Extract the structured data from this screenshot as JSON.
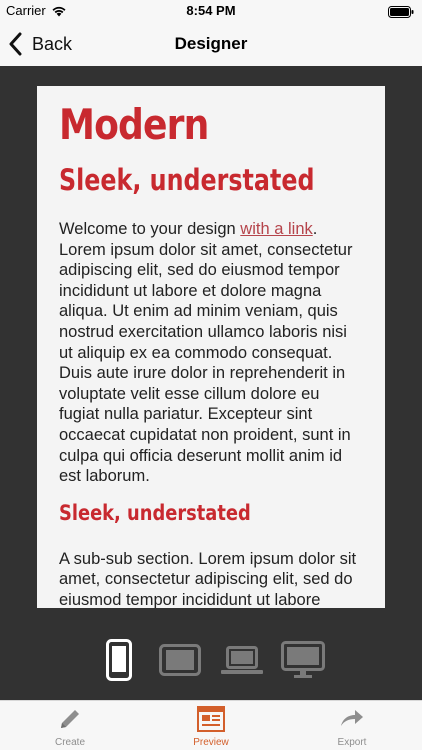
{
  "status_bar": {
    "carrier": "Carrier",
    "time": "8:54 PM"
  },
  "nav": {
    "back_label": "Back",
    "title": "Designer"
  },
  "preview": {
    "heading1": "Modern",
    "heading2": "Sleek, understated",
    "intro_text": "Welcome to your design ",
    "link_text": "with a link",
    "intro_after_link": ".",
    "body": "Lorem ipsum dolor sit amet, consectetur adipiscing elit, sed do eiusmod tempor incididunt ut labore et dolore magna aliqua. Ut enim ad minim veniam, quis nostrud exercitation ullamco laboris nisi ut aliquip ex ea commodo consequat. Duis aute irure dolor in reprehenderit in voluptate velit esse cillum dolore eu fugiat nulla pariatur. Excepteur sint occaecat cupidatat non proident, sunt in culpa qui officia deserunt mollit anim id est laborum.",
    "heading3": "Sleek, understated",
    "sub_body": "A sub-sub section. Lorem ipsum dolor sit amet, consectetur adipiscing elit, sed do eiusmod tempor incididunt ut labore"
  },
  "devices": {
    "selected": "phone",
    "items": [
      "phone",
      "tablet",
      "laptop",
      "desktop"
    ]
  },
  "tabs": [
    {
      "label": "Create",
      "icon": "pencil-icon",
      "active": false
    },
    {
      "label": "Preview",
      "icon": "preview-icon",
      "active": true
    },
    {
      "label": "Export",
      "icon": "share-arrow-icon",
      "active": false
    }
  ],
  "colors": {
    "accent_red": "#c8292f",
    "tab_active": "#d35f2b",
    "dark_bg": "#323232"
  }
}
